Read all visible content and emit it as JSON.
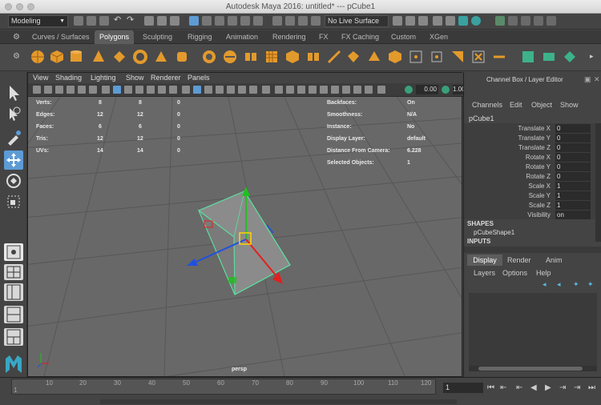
{
  "window": {
    "title": "Autodesk Maya 2016: untitled*   ---   pCube1"
  },
  "status_line": {
    "menu_set": "Modeling",
    "live_surface": "No Live Surface"
  },
  "shelf_tabs": [
    "Curves / Surfaces",
    "Polygons",
    "Sculpting",
    "Rigging",
    "Animation",
    "Rendering",
    "FX",
    "FX Caching",
    "Custom",
    "XGen"
  ],
  "active_shelf_tab": "Polygons",
  "viewport": {
    "menu": [
      "View",
      "Shading",
      "Lighting",
      "Show",
      "Renderer",
      "Panels"
    ],
    "field_value": "0.00",
    "field_value2": "1.00",
    "camera_label": "persp",
    "hud_left": [
      {
        "label": "Verts:",
        "a": "8",
        "b": "8",
        "c": "0"
      },
      {
        "label": "Edges:",
        "a": "12",
        "b": "12",
        "c": "0"
      },
      {
        "label": "Faces:",
        "a": "6",
        "b": "6",
        "c": "0"
      },
      {
        "label": "Tris:",
        "a": "12",
        "b": "12",
        "c": "0"
      },
      {
        "label": "UVs:",
        "a": "14",
        "b": "14",
        "c": "0"
      }
    ],
    "hud_right": [
      {
        "label": "Backfaces:",
        "value": "On"
      },
      {
        "label": "Smoothness:",
        "value": "N/A"
      },
      {
        "label": "Instance:",
        "value": "No"
      },
      {
        "label": "Display Layer:",
        "value": "default"
      },
      {
        "label": "Distance From Camera:",
        "value": "6.228"
      },
      {
        "label": "Selected Objects:",
        "value": "1"
      }
    ]
  },
  "channel_box": {
    "title": "Channel Box / Layer Editor",
    "menu": [
      "Channels",
      "Edit",
      "Object",
      "Show"
    ],
    "object_name": "pCube1",
    "channels": [
      {
        "label": "Translate X",
        "value": "0"
      },
      {
        "label": "Translate Y",
        "value": "0"
      },
      {
        "label": "Translate Z",
        "value": "0"
      },
      {
        "label": "Rotate X",
        "value": "0"
      },
      {
        "label": "Rotate Y",
        "value": "0"
      },
      {
        "label": "Rotate Z",
        "value": "0"
      },
      {
        "label": "Scale X",
        "value": "1"
      },
      {
        "label": "Scale Y",
        "value": "1"
      },
      {
        "label": "Scale Z",
        "value": "1"
      },
      {
        "label": "Visibility",
        "value": "on"
      }
    ],
    "shapes_header": "SHAPES",
    "shape_name": "pCubeShape1",
    "inputs_header": "INPUTS",
    "layer_tabs": [
      "Display",
      "Render",
      "Anim"
    ],
    "layer_menu": [
      "Layers",
      "Options",
      "Help"
    ]
  },
  "timeline": {
    "ticks": [
      "1",
      "10",
      "20",
      "30",
      "40",
      "50",
      "60",
      "70",
      "80",
      "90",
      "100",
      "110",
      "120"
    ],
    "current_frame": "1",
    "left_frame": "1"
  },
  "colors": {
    "accent": "#5d9bd5",
    "selection": "#5ce0a0",
    "x_axis": "#e02020",
    "y_axis": "#20c020",
    "z_axis": "#2050e0"
  }
}
